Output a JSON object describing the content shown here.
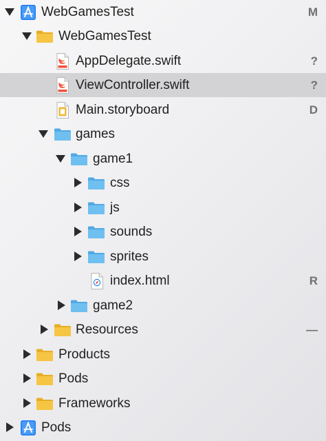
{
  "navigator": {
    "items": [
      {
        "label": "WebGamesTest",
        "status": "M",
        "icon": "xcode-project-icon",
        "name": "project-webgamestest",
        "expanded": true
      },
      {
        "label": "WebGamesTest",
        "status": "",
        "icon": "group-folder-icon",
        "name": "group-webgamestest",
        "expanded": true
      },
      {
        "label": "AppDelegate.swift",
        "status": "?",
        "icon": "swift-file-icon",
        "name": "file-appdelegate-swift"
      },
      {
        "label": "ViewController.swift",
        "status": "?",
        "icon": "swift-file-icon",
        "name": "file-viewcontroller-swift",
        "selected": true
      },
      {
        "label": "Main.storyboard",
        "status": "D",
        "icon": "storyboard-file-icon",
        "name": "file-main-storyboard"
      },
      {
        "label": "games",
        "status": "",
        "icon": "folder-icon",
        "name": "folder-games",
        "expanded": true
      },
      {
        "label": "game1",
        "status": "",
        "icon": "folder-icon",
        "name": "folder-game1",
        "expanded": true
      },
      {
        "label": "css",
        "status": "",
        "icon": "folder-icon",
        "name": "folder-css",
        "expanded": false
      },
      {
        "label": "js",
        "status": "",
        "icon": "folder-icon",
        "name": "folder-js",
        "expanded": false
      },
      {
        "label": "sounds",
        "status": "",
        "icon": "folder-icon",
        "name": "folder-sounds",
        "expanded": false
      },
      {
        "label": "sprites",
        "status": "",
        "icon": "folder-icon",
        "name": "folder-sprites",
        "expanded": false
      },
      {
        "label": "index.html",
        "status": "R",
        "icon": "html-file-icon",
        "name": "file-index-html"
      },
      {
        "label": "game2",
        "status": "",
        "icon": "folder-icon",
        "name": "folder-game2",
        "expanded": false
      },
      {
        "label": "Resources",
        "status": "—",
        "icon": "group-folder-icon",
        "name": "group-resources",
        "expanded": false
      },
      {
        "label": "Products",
        "status": "",
        "icon": "group-folder-icon",
        "name": "group-products",
        "expanded": false
      },
      {
        "label": "Pods",
        "status": "",
        "icon": "group-folder-icon",
        "name": "group-pods",
        "expanded": false
      },
      {
        "label": "Frameworks",
        "status": "",
        "icon": "group-folder-icon",
        "name": "group-frameworks",
        "expanded": false
      },
      {
        "label": "Pods",
        "status": "",
        "icon": "xcode-project-icon",
        "name": "project-pods",
        "expanded": false
      }
    ]
  },
  "colors": {
    "selection": "#d3d3d6",
    "blue_folder": "#6fbff0",
    "yellow_folder": "#f6c544",
    "swift_orange": "#f05138",
    "project_blue": "#1e7cf2",
    "status_gray": "#707070"
  }
}
